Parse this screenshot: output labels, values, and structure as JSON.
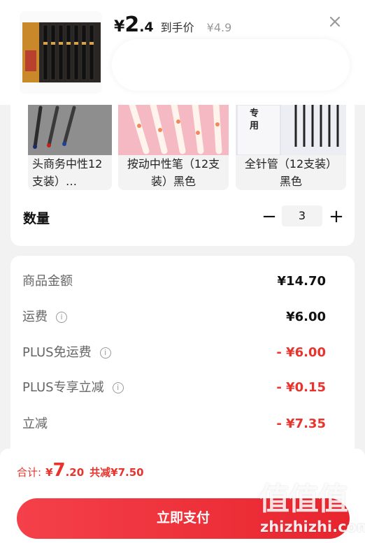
{
  "product": {
    "price_currency": "¥",
    "price_int": "2",
    "price_dec": ".4",
    "price_tag": "到手价",
    "original_price": "¥4.9",
    "thumb_icon": "pen-box-image"
  },
  "variants": [
    {
      "label": "头商务中性12支装）…",
      "icon": "gel-pen-set-image"
    },
    {
      "label": "按动中性笔（12支装）黑色",
      "icon": "press-pen-pink-image"
    },
    {
      "label": "全针管（12支装）黑色",
      "icon": "needle-pen-box-image"
    }
  ],
  "quantity": {
    "label": "数量",
    "value": "3",
    "minus": "−",
    "plus": "+"
  },
  "fees": [
    {
      "label": "商品金额",
      "value": "¥14.70",
      "info": false,
      "color": "#111111"
    },
    {
      "label": "运费",
      "value": "¥6.00",
      "info": true,
      "color": "#111111"
    },
    {
      "label": "PLUS免运费",
      "value": "- ¥6.00",
      "info": true,
      "color": "#e8342c"
    },
    {
      "label": "PLUS专享立减",
      "value": "- ¥0.15",
      "info": true,
      "color": "#e8342c"
    },
    {
      "label": "立减",
      "value": "- ¥7.35",
      "info": false,
      "color": "#e8342c"
    }
  ],
  "footer": {
    "total_label": "合计:",
    "total_currency": "¥",
    "total_int": "7",
    "total_dec": ".20",
    "total_saved": "共减¥7.50",
    "pay_label": "立即支付"
  },
  "watermark": {
    "glyphs": "值值值",
    "url": "zhizhizhi.com"
  },
  "colors": {
    "accent": "#e8342c",
    "pay_button": "#f03a43"
  }
}
